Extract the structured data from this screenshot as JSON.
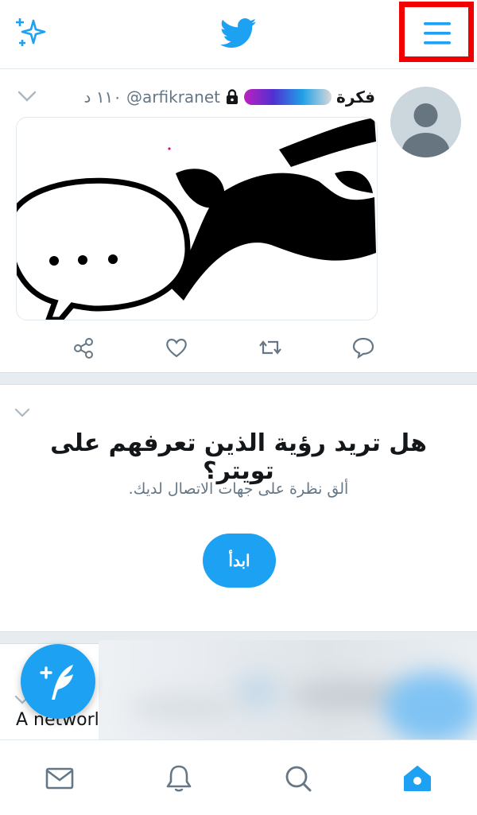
{
  "tweet": {
    "display_name": "فكرة",
    "handle": "@arfikranet",
    "time": "١١٠ د"
  },
  "prompt": {
    "title": "هل تريد رؤية الذين تعرفهم على تويتر؟",
    "subtitle": "ألق نظرة على جهات الاتصال لديك.",
    "button": "ابدأ"
  },
  "next_tweet": {
    "text": "A networl"
  },
  "icons": {
    "sparkle": "sparkle-icon",
    "logo": "twitter-bird-icon",
    "menu": "hamburger-menu-icon",
    "compose": "compose-icon",
    "nav": [
      "mail-icon",
      "bell-icon",
      "search-icon",
      "home-icon"
    ]
  },
  "colors": {
    "accent": "#1da1f2",
    "highlight": "#f20000"
  }
}
